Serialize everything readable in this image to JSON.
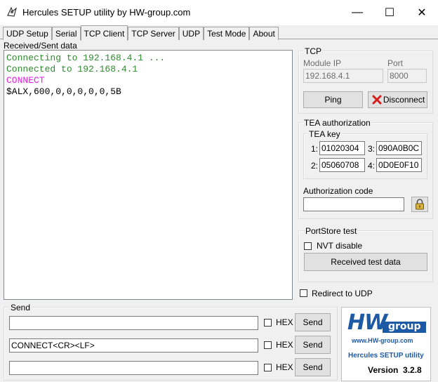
{
  "window": {
    "title": "Hercules SETUP utility by HW-group.com",
    "icon": "hercules-icon",
    "minimize_glyph": "—",
    "maximize_glyph": "☐",
    "close_glyph": "✕"
  },
  "tabs": [
    {
      "label": "UDP Setup",
      "active": false
    },
    {
      "label": "Serial",
      "active": false
    },
    {
      "label": "TCP Client",
      "active": true
    },
    {
      "label": "TCP Server",
      "active": false
    },
    {
      "label": "UDP",
      "active": false
    },
    {
      "label": "Test Mode",
      "active": false
    },
    {
      "label": "About",
      "active": false
    }
  ],
  "received": {
    "label": "Received/Sent data",
    "lines": [
      {
        "text": "Connecting to 192.168.4.1 ...",
        "color": "#2e8b2e"
      },
      {
        "text": "Connected to 192.168.4.1",
        "color": "#2e8b2e"
      },
      {
        "text": "CONNECT",
        "color": "#e61ee6"
      },
      {
        "text": "$ALX,600,0,0,0,0,0,5B",
        "color": "#000000"
      }
    ]
  },
  "tcp": {
    "group_label": "TCP",
    "module_ip_label": "Module IP",
    "module_ip_value": "192.168.4.1",
    "port_label": "Port",
    "port_value": "8000",
    "ping_label": "Ping",
    "disconnect_label": "Disconnect",
    "disconnect_icon_color": "#d21e1e"
  },
  "tea": {
    "group_label": "TEA authorization",
    "key_label": "TEA key",
    "keys": [
      {
        "num": "1:",
        "value": "01020304"
      },
      {
        "num": "3:",
        "value": "090A0B0C"
      },
      {
        "num": "2:",
        "value": "05060708"
      },
      {
        "num": "4:",
        "value": "0D0E0F10"
      }
    ],
    "auth_code_label": "Authorization code",
    "auth_code_value": ""
  },
  "portstore": {
    "group_label": "PortStore test",
    "nvt_label": "NVT disable",
    "received_test_label": "Received test data"
  },
  "redirect_label": "Redirect to UDP",
  "send": {
    "group_label": "Send",
    "rows": [
      {
        "value": "",
        "hex_label": "HEX",
        "button": "Send"
      },
      {
        "value": "CONNECT<CR><LF>",
        "hex_label": "HEX",
        "button": "Send"
      },
      {
        "value": "",
        "hex_label": "HEX",
        "button": "Send"
      }
    ]
  },
  "logo": {
    "brand": "HW",
    "group": "group",
    "url": "www.HW-group.com",
    "product": "Hercules SETUP utility",
    "version": "Version  3.2.8",
    "brand_color": "#1c5aa6"
  }
}
